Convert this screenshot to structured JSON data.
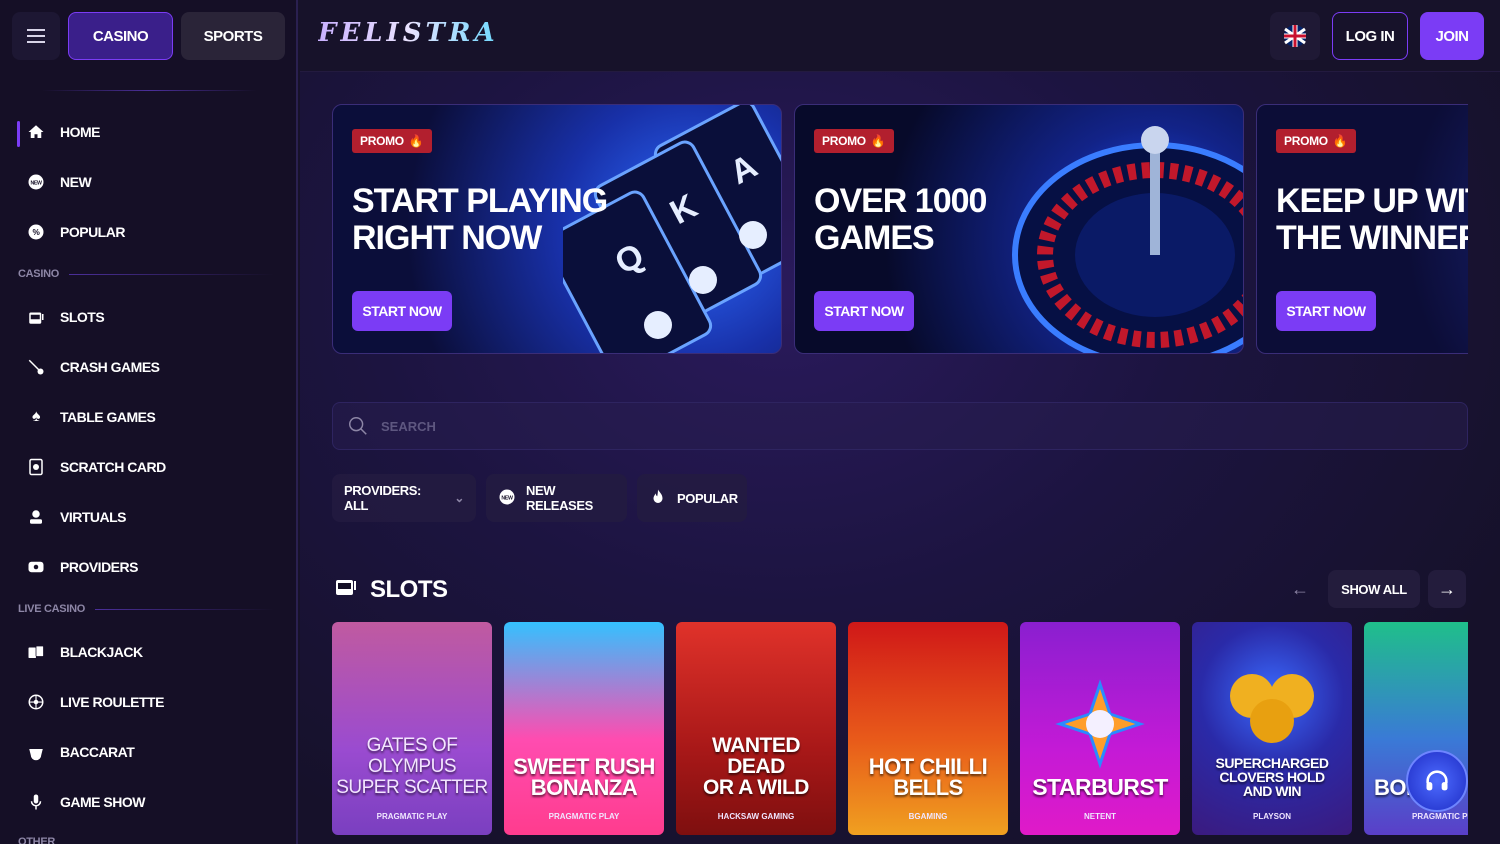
{
  "app": {
    "logo": "FELISTRA"
  },
  "topbar": {
    "casino_tab": "CASINO",
    "sports_tab": "SPORTS",
    "login": "LOG IN",
    "join": "JOIN"
  },
  "sidebar": {
    "top_items": [
      {
        "label": "HOME",
        "icon": "home-icon"
      },
      {
        "label": "NEW",
        "icon": "new-badge-icon"
      },
      {
        "label": "POPULAR",
        "icon": "popular-icon"
      }
    ],
    "casino_section": "CASINO",
    "casino_items": [
      {
        "label": "SLOTS",
        "icon": "slot-machine-icon"
      },
      {
        "label": "CRASH GAMES",
        "icon": "comet-icon"
      },
      {
        "label": "TABLE GAMES",
        "icon": "spade-icon"
      },
      {
        "label": "SCRATCH CARD",
        "icon": "scratch-card-icon"
      },
      {
        "label": "VIRTUALS",
        "icon": "virtuals-icon"
      },
      {
        "label": "PROVIDERS",
        "icon": "providers-icon"
      }
    ],
    "live_section": "LIVE CASINO",
    "live_items": [
      {
        "label": "BLACKJACK",
        "icon": "cards-icon"
      },
      {
        "label": "LIVE ROULETTE",
        "icon": "roulette-icon"
      },
      {
        "label": "BACCARAT",
        "icon": "baccarat-icon"
      },
      {
        "label": "GAME SHOW",
        "icon": "microphone-icon"
      }
    ],
    "other_section": "OTHER"
  },
  "banners": [
    {
      "badge": "PROMO",
      "line1": "START PLAYING",
      "line2": "RIGHT NOW",
      "button": "START NOW"
    },
    {
      "badge": "PROMO",
      "line1": "OVER 1000",
      "line2": "GAMES",
      "button": "START NOW"
    },
    {
      "badge": "PROMO",
      "line1": "KEEP UP WITH",
      "line2": "THE WINNERS",
      "button": "START NOW"
    }
  ],
  "search": {
    "placeholder": "SEARCH"
  },
  "filters": {
    "providers": "PROVIDERS: ALL",
    "new_releases": "NEW RELEASES",
    "popular": "POPULAR"
  },
  "slots": {
    "title": "SLOTS",
    "show_all": "SHOW ALL",
    "games": [
      {
        "line1": "GATES OF OLYMPUS",
        "line2": "SUPER SCATTER",
        "line3": "",
        "provider": "PRAGMATIC PLAY"
      },
      {
        "line1": "SWEET RUSH",
        "line2": "BONANZA",
        "line3": "",
        "provider": "PRAGMATIC PLAY"
      },
      {
        "line1": "WANTED",
        "line2": "DEAD",
        "line3": "OR A WILD",
        "provider": "HACKSAW GAMING"
      },
      {
        "line1": "HOT CHILLI",
        "line2": "BELLS",
        "line3": "",
        "provider": "BGAMING"
      },
      {
        "line1": "STARBURST",
        "line2": "",
        "line3": "",
        "provider": "NETENT"
      },
      {
        "line1": "SUPERCHARGED",
        "line2": "CLOVERS HOLD",
        "line3": "AND WIN",
        "provider": "PLAYSON"
      },
      {
        "line1": "BOI",
        "line2": "",
        "line3": "",
        "provider": "PRAGMATIC PLA"
      }
    ]
  },
  "colors": {
    "accent": "#7b3cf5",
    "promo": "#b21f2e",
    "bg": "#17122a"
  }
}
